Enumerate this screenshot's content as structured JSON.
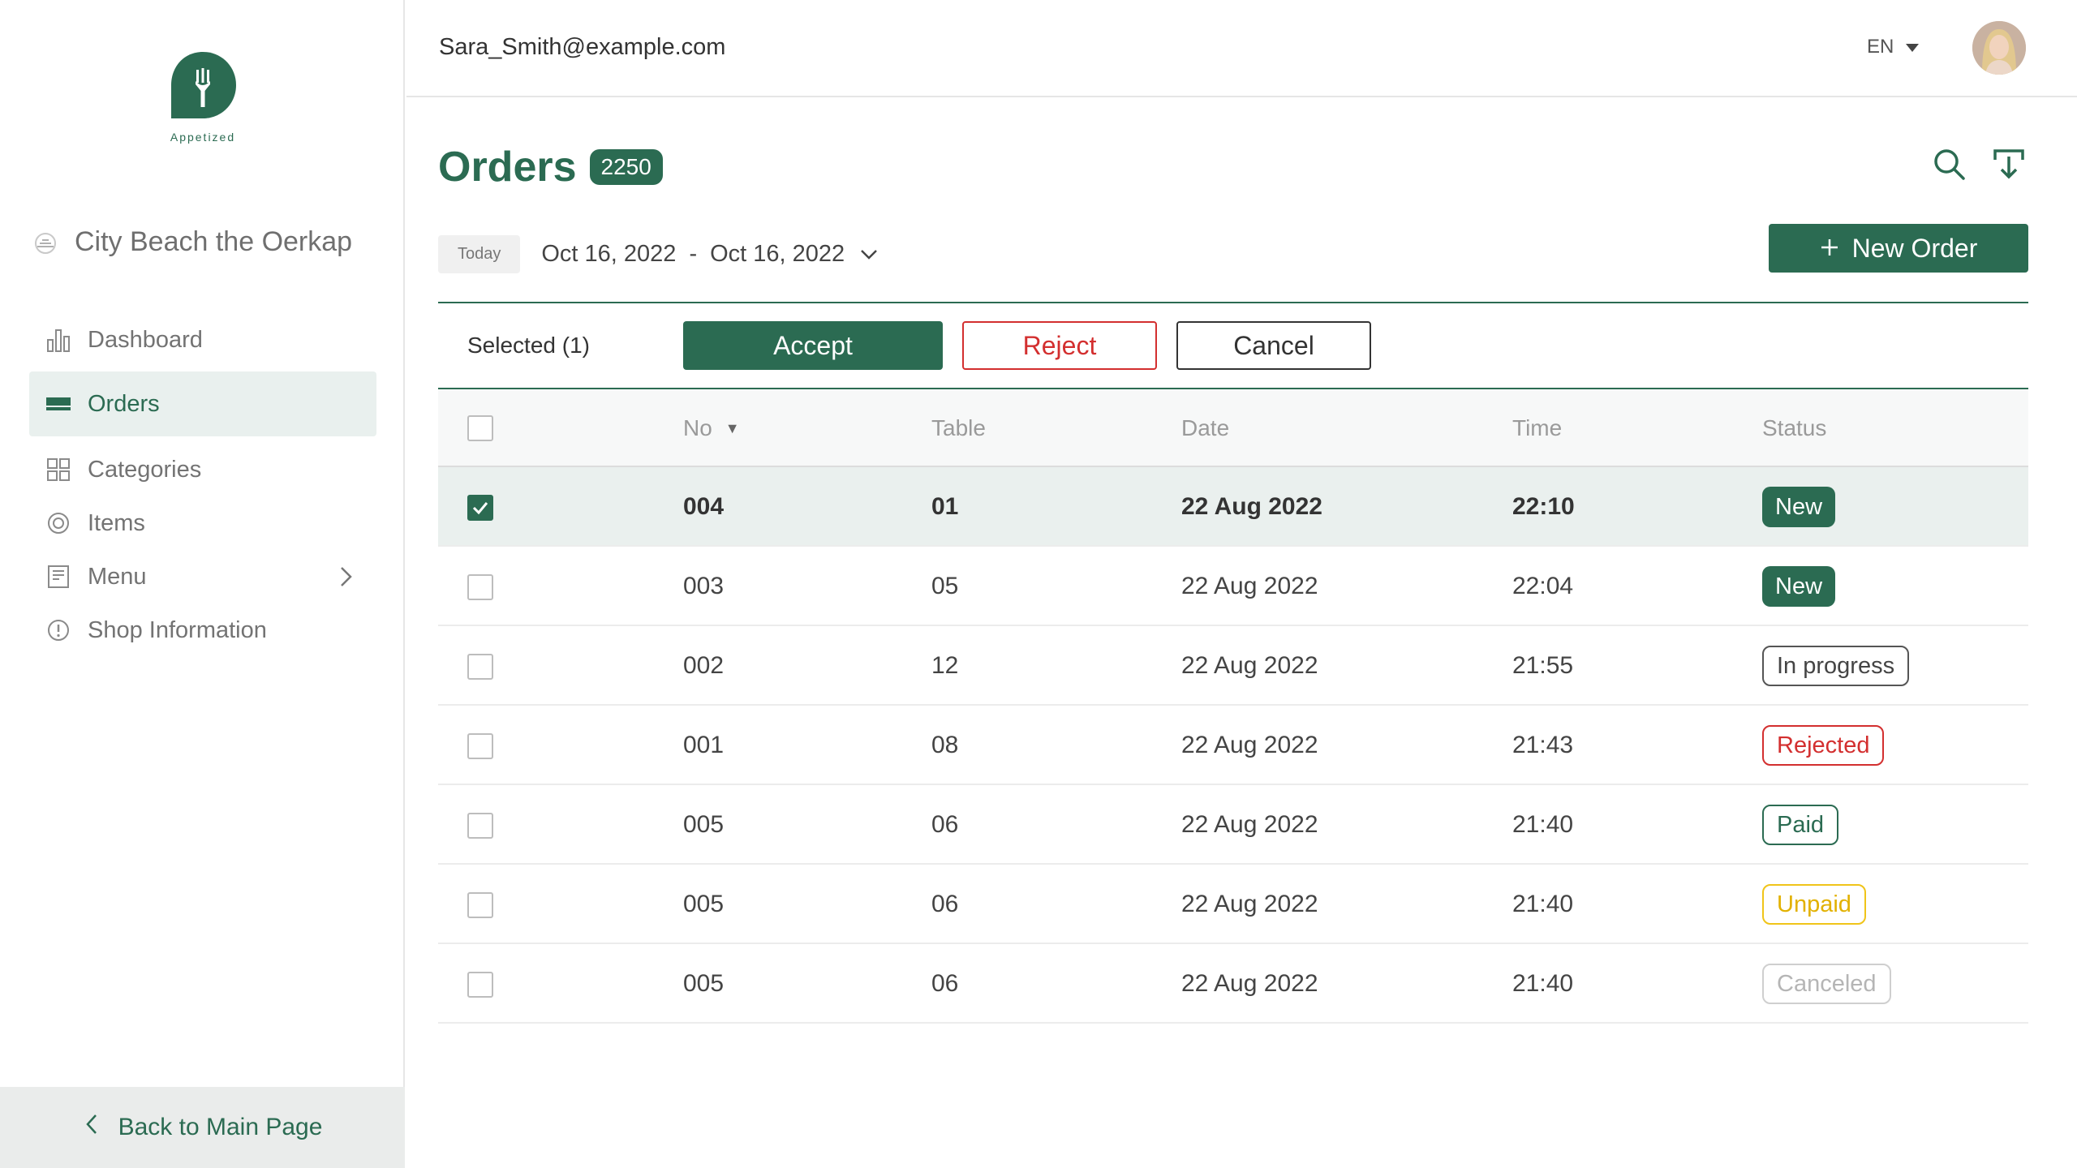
{
  "brand": {
    "name": "Appetized",
    "color": "#2b6b52"
  },
  "sidebar": {
    "venue_name": "City Beach the Oerkap",
    "items": [
      {
        "label": "Dashboard",
        "icon": "bar-chart-icon"
      },
      {
        "label": "Orders",
        "icon": "orders-icon",
        "active": true
      },
      {
        "label": "Categories",
        "icon": "grid-icon"
      },
      {
        "label": "Items",
        "icon": "target-icon"
      },
      {
        "label": "Menu",
        "icon": "book-icon",
        "has_submenu": true
      },
      {
        "label": "Shop Information",
        "icon": "info-icon"
      }
    ],
    "back_label": "Back to Main Page"
  },
  "header": {
    "email": "Sara_Smith@example.com",
    "language": "EN"
  },
  "main": {
    "title": "Orders",
    "count": "2250",
    "today_label": "Today",
    "date_from": "Oct 16, 2022",
    "date_separator": "-",
    "date_to": "Oct 16, 2022",
    "new_order_label": "New Order"
  },
  "actions": {
    "selected_label": "Selected (1)",
    "accept_label": "Accept",
    "reject_label": "Reject",
    "cancel_label": "Cancel"
  },
  "table": {
    "columns": {
      "no": "No",
      "table": "Table",
      "date": "Date",
      "time": "Time",
      "status": "Status"
    },
    "rows": [
      {
        "no": "004",
        "table": "01",
        "date": "22 Aug 2022",
        "time": "22:10",
        "status": "New",
        "selected": true
      },
      {
        "no": "003",
        "table": "05",
        "date": "22 Aug 2022",
        "time": "22:04",
        "status": "New",
        "selected": false
      },
      {
        "no": "002",
        "table": "12",
        "date": "22 Aug 2022",
        "time": "21:55",
        "status": "In progress",
        "selected": false
      },
      {
        "no": "001",
        "table": "08",
        "date": "22 Aug 2022",
        "time": "21:43",
        "status": "Rejected",
        "selected": false
      },
      {
        "no": "005",
        "table": "06",
        "date": "22 Aug 2022",
        "time": "21:40",
        "status": "Paid",
        "selected": false
      },
      {
        "no": "005",
        "table": "06",
        "date": "22 Aug 2022",
        "time": "21:40",
        "status": "Unpaid",
        "selected": false
      },
      {
        "no": "005",
        "table": "06",
        "date": "22 Aug 2022",
        "time": "21:40",
        "status": "Canceled",
        "selected": false
      }
    ]
  },
  "status_colors": {
    "New": "#2b6b52",
    "In progress": "#555555",
    "Rejected": "#d32f2f",
    "Paid": "#2b6b52",
    "Unpaid": "#e2b100",
    "Canceled": "#b5b5b5"
  }
}
